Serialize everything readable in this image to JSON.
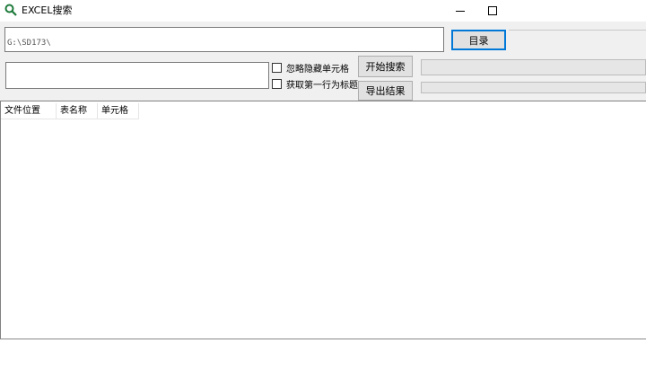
{
  "window": {
    "title": "EXCEL搜索",
    "icon": "magnifier-icon"
  },
  "search": {
    "path_value": "G:\\SD173\\",
    "keyword_value": "",
    "directory_button_label": "目录",
    "ignore_hidden_label": "忽略隐藏单元格",
    "ignore_hidden_checked": false,
    "first_row_title_label": "获取第一行为标题",
    "first_row_title_checked": false,
    "start_search_label": "开始搜索",
    "export_label": "导出结果",
    "progress_1": 0,
    "progress_2": 0
  },
  "results": {
    "columns": [
      "文件位置",
      "表名称",
      "单元格"
    ],
    "rows": []
  }
}
